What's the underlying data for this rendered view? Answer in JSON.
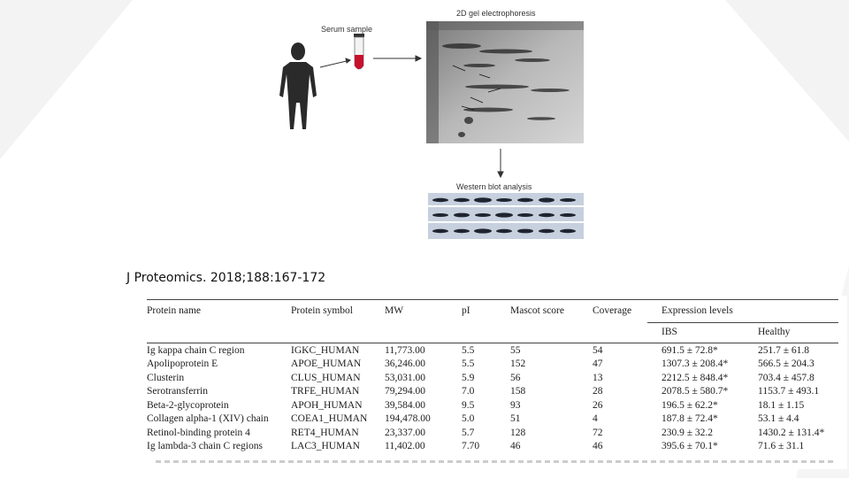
{
  "figure": {
    "serum_label": "Serum sample",
    "gel_label": "2D gel electrophoresis",
    "blot_label": "Western blot analysis"
  },
  "citation": "J Proteomics. 2018;188:167-172",
  "table": {
    "headers": {
      "protein_name": "Protein name",
      "protein_symbol": "Protein symbol",
      "mw": "MW",
      "pi": "pI",
      "mascot": "Mascot score",
      "coverage": "Coverage",
      "expression": "Expression levels"
    },
    "subheaders": {
      "ibs": "IBS",
      "healthy": "Healthy"
    },
    "rows": [
      {
        "name": "Ig kappa chain C region",
        "symbol": "IGKC_HUMAN",
        "mw": "11,773.00",
        "pi": "5.5",
        "mascot": "55",
        "coverage": "54",
        "ibs": "691.5 ± 72.8*",
        "healthy": "251.7 ± 61.8"
      },
      {
        "name": "Apolipoprotein E",
        "symbol": "APOE_HUMAN",
        "mw": "36,246.00",
        "pi": "5.5",
        "mascot": "152",
        "coverage": "47",
        "ibs": "1307.3 ± 208.4*",
        "healthy": "566.5 ± 204.3"
      },
      {
        "name": "Clusterin",
        "symbol": "CLUS_HUMAN",
        "mw": "53,031.00",
        "pi": "5.9",
        "mascot": "56",
        "coverage": "13",
        "ibs": "2212.5 ± 848.4*",
        "healthy": "703.4 ± 457.8"
      },
      {
        "name": "Serotransferrin",
        "symbol": "TRFE_HUMAN",
        "mw": "79,294.00",
        "pi": "7.0",
        "mascot": "158",
        "coverage": "28",
        "ibs": "2078.5 ± 580.7*",
        "healthy": "1153.7 ± 493.1"
      },
      {
        "name": "Beta-2-glycoprotein",
        "symbol": "APOH_HUMAN",
        "mw": "39,584.00",
        "pi": "9.5",
        "mascot": "93",
        "coverage": "26",
        "ibs": "196.5 ± 62.2*",
        "healthy": "18.1 ± 1.15"
      },
      {
        "name": "Collagen alpha-1 (XIV) chain",
        "symbol": "COEA1_HUMAN",
        "mw": "194,478.00",
        "pi": "5.0",
        "mascot": "51",
        "coverage": "4",
        "ibs": "187.8 ± 72.4*",
        "healthy": "53.1 ± 4.4"
      },
      {
        "name": "Retinol-binding protein 4",
        "symbol": "RET4_HUMAN",
        "mw": "23,337.00",
        "pi": "5.7",
        "mascot": "128",
        "coverage": "72",
        "ibs": "230.9 ± 32.2",
        "healthy": "1430.2 ± 131.4*"
      },
      {
        "name": "Ig lambda-3 chain C regions",
        "symbol": "LAC3_HUMAN",
        "mw": "11,402.00",
        "pi": "7.70",
        "mascot": "46",
        "coverage": "46",
        "ibs": "395.6 ± 70.1*",
        "healthy": "71.6 ± 31.1"
      }
    ]
  }
}
